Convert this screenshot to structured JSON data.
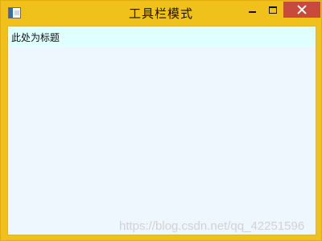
{
  "window": {
    "title": "工具栏模式",
    "controls": {
      "minimize_icon": "minimize-icon",
      "maximize_icon": "maximize-icon",
      "close_icon": "close-icon"
    },
    "colors": {
      "frame": "#f0c11b",
      "close_button": "#c74a3c",
      "client_background": "#eef6fe",
      "toolbar_background": "#e0ffff"
    }
  },
  "toolbar": {
    "label": "此处为标题"
  },
  "watermark": {
    "text": "https://blog.csdn.net/qq_42251596"
  }
}
